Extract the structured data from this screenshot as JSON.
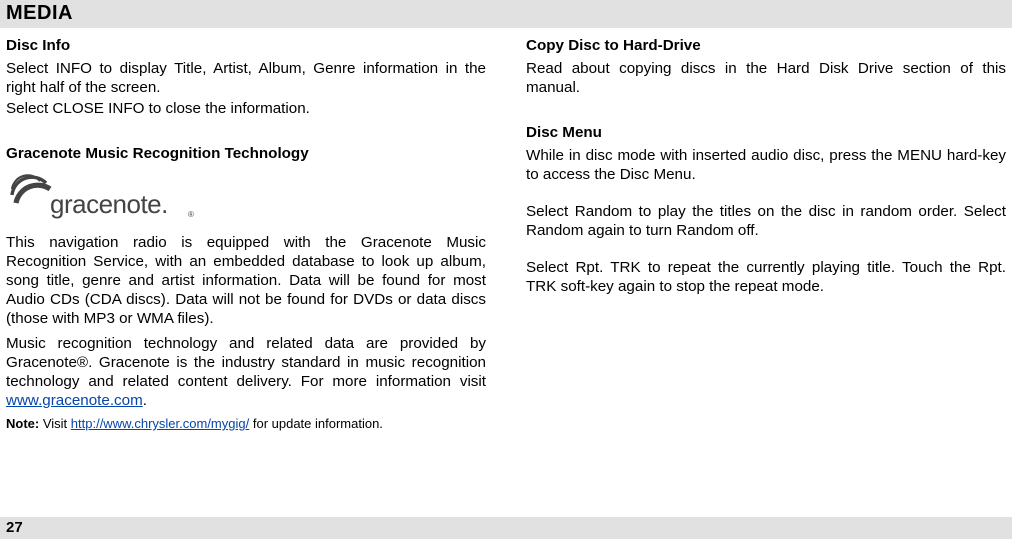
{
  "header": {
    "title": "MEDIA"
  },
  "footer": {
    "page_number": "27"
  },
  "left": {
    "disc_info": {
      "heading": "Disc Info",
      "p1": "Select INFO to display Title, Artist, Album, Genre information in the right half of the screen.",
      "p2": "Select CLOSE INFO to close the information."
    },
    "gracenote": {
      "heading": "Gracenote Music Recognition Technology",
      "logo_text": "gracenote",
      "logo_dot": ".",
      "p1": "This navigation radio is equipped with the Gracenote Music Recognition Service, with an embedded database to look up album, song title, genre and artist information.  Data will be found for most Audio CDs (CDA discs).  Data will not be found for DVDs or data discs (those with MP3 or WMA files).",
      "p2a": "Music recognition technology and related data are provided by Gracenote®. Gracenote is the industry standard in music recognition technology and related content delivery. For more information visit ",
      "p2_link_text": "www.gracenote.com",
      "p2_link_href": "http://www.gracenote.com",
      "p2b": ".",
      "note_prefix": "Note:",
      "note_a": " Visit ",
      "note_link_text": "http://www.chrysler.com/mygig/",
      "note_link_href": "http://www.chrysler.com/mygig/",
      "note_b": " for update information."
    }
  },
  "right": {
    "copy": {
      "heading": "Copy Disc to Hard-Drive",
      "p1": "Read about copying discs in the Hard Disk Drive section of this manual."
    },
    "disc_menu": {
      "heading": "Disc Menu",
      "p1": "While in disc mode with inserted audio disc, press the MENU hard-key to access the Disc Menu.",
      "p2": "Select Random to play the titles on the disc in random order. Select Random again to turn Random off.",
      "p3": "Select Rpt. TRK to repeat the currently playing title. Touch the Rpt. TRK soft-key again to stop the repeat mode."
    }
  }
}
